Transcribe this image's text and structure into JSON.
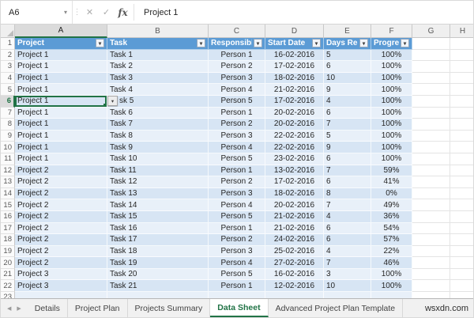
{
  "formula_bar": {
    "name_box": "A6",
    "fx_label": "fx",
    "formula_value": "Project 1"
  },
  "icons": {
    "name_box_caret": "▾",
    "splitter_dots": "⋮",
    "cancel": "✕",
    "enter": "✓",
    "filter_arrow": "▾",
    "dropdown_arrow": "▾",
    "tab_prev": "◀",
    "tab_next": "▶"
  },
  "grid": {
    "column_letters": [
      "A",
      "B",
      "C",
      "D",
      "E",
      "F",
      "G",
      "H"
    ],
    "selected_column": "A",
    "selected_row": 6,
    "selected_cell": "A6",
    "header_row_number": 1,
    "headers": [
      "Project",
      "Task",
      "Responsible",
      "Start Date",
      "Days Req.",
      "Progress"
    ],
    "rows": [
      {
        "n": 2,
        "project": "Project 1",
        "task": "Task 1",
        "responsible": "Person 1",
        "start": "16-02-2016",
        "days": 5,
        "progress": "100%"
      },
      {
        "n": 3,
        "project": "Project 1",
        "task": "Task 2",
        "responsible": "Person 2",
        "start": "17-02-2016",
        "days": 6,
        "progress": "100%"
      },
      {
        "n": 4,
        "project": "Project 1",
        "task": "Task 3",
        "responsible": "Person 3",
        "start": "18-02-2016",
        "days": 10,
        "progress": "100%"
      },
      {
        "n": 5,
        "project": "Project 1",
        "task": "Task 4",
        "responsible": "Person 4",
        "start": "21-02-2016",
        "days": 9,
        "progress": "100%"
      },
      {
        "n": 6,
        "project": "Project 1",
        "task": "sk 5",
        "responsible": "Person 5",
        "start": "17-02-2016",
        "days": 4,
        "progress": "100%"
      },
      {
        "n": 7,
        "project": "Project 1",
        "task": "Task 6",
        "responsible": "Person 1",
        "start": "20-02-2016",
        "days": 6,
        "progress": "100%"
      },
      {
        "n": 8,
        "project": "Project 1",
        "task": "Task 7",
        "responsible": "Person 2",
        "start": "20-02-2016",
        "days": 7,
        "progress": "100%"
      },
      {
        "n": 9,
        "project": "Project 1",
        "task": "Task 8",
        "responsible": "Person 3",
        "start": "22-02-2016",
        "days": 5,
        "progress": "100%"
      },
      {
        "n": 10,
        "project": "Project 1",
        "task": "Task 9",
        "responsible": "Person 4",
        "start": "22-02-2016",
        "days": 9,
        "progress": "100%"
      },
      {
        "n": 11,
        "project": "Project 1",
        "task": "Task 10",
        "responsible": "Person 5",
        "start": "23-02-2016",
        "days": 6,
        "progress": "100%"
      },
      {
        "n": 12,
        "project": "Project 2",
        "task": "Task 11",
        "responsible": "Person 1",
        "start": "13-02-2016",
        "days": 7,
        "progress": "59%"
      },
      {
        "n": 13,
        "project": "Project 2",
        "task": "Task 12",
        "responsible": "Person 2",
        "start": "17-02-2016",
        "days": 6,
        "progress": "41%"
      },
      {
        "n": 14,
        "project": "Project 2",
        "task": "Task 13",
        "responsible": "Person 3",
        "start": "18-02-2016",
        "days": 8,
        "progress": "0%"
      },
      {
        "n": 15,
        "project": "Project 2",
        "task": "Task 14",
        "responsible": "Person 4",
        "start": "20-02-2016",
        "days": 7,
        "progress": "49%"
      },
      {
        "n": 16,
        "project": "Project 2",
        "task": "Task 15",
        "responsible": "Person 5",
        "start": "21-02-2016",
        "days": 4,
        "progress": "36%"
      },
      {
        "n": 17,
        "project": "Project 2",
        "task": "Task 16",
        "responsible": "Person 1",
        "start": "21-02-2016",
        "days": 6,
        "progress": "54%"
      },
      {
        "n": 18,
        "project": "Project 2",
        "task": "Task 17",
        "responsible": "Person 2",
        "start": "24-02-2016",
        "days": 6,
        "progress": "57%"
      },
      {
        "n": 19,
        "project": "Project 2",
        "task": "Task 18",
        "responsible": "Person 3",
        "start": "25-02-2016",
        "days": 4,
        "progress": "22%"
      },
      {
        "n": 20,
        "project": "Project 2",
        "task": "Task 19",
        "responsible": "Person 4",
        "start": "27-02-2016",
        "days": 7,
        "progress": "46%"
      },
      {
        "n": 21,
        "project": "Project 3",
        "task": "Task 20",
        "responsible": "Person 5",
        "start": "16-02-2016",
        "days": 3,
        "progress": "100%"
      },
      {
        "n": 22,
        "project": "Project 3",
        "task": "Task 21",
        "responsible": "Person 1",
        "start": "12-02-2016",
        "days": 10,
        "progress": "100%"
      },
      {
        "n": 23,
        "project": "",
        "task": "",
        "responsible": "",
        "start": "",
        "days": "",
        "progress": ""
      }
    ]
  },
  "sheet_tabs": {
    "tabs": [
      {
        "label": "Details",
        "active": false
      },
      {
        "label": "Project Plan",
        "active": false
      },
      {
        "label": "Projects Summary",
        "active": false
      },
      {
        "label": "Data Sheet",
        "active": true
      },
      {
        "label": "Advanced Project Plan Template",
        "active": false
      }
    ]
  },
  "watermark": "wsxdn.com",
  "colors": {
    "accent_green": "#217346",
    "header_blue": "#5B9BD5",
    "band_light": "#D7E5F4",
    "band_lighter": "#E8F0F9"
  }
}
